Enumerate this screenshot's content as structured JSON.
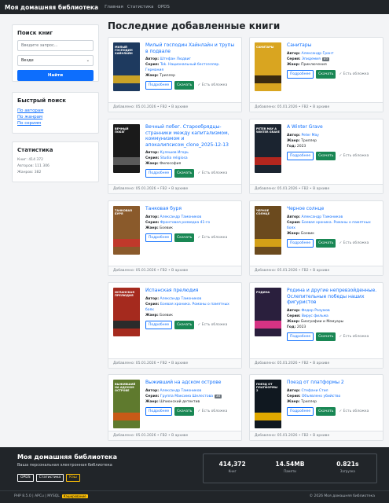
{
  "nav": {
    "brand": "Моя домашняя библиотека",
    "links": [
      "Главная",
      "Статистика",
      "OPDS"
    ]
  },
  "search": {
    "title": "Поиск книг",
    "placeholder": "Введите запрос...",
    "scope": "Везде",
    "button": "Найти"
  },
  "quick": {
    "title": "Быстрый поиск",
    "links": [
      "По авторам",
      "По жанрам",
      "По сериям"
    ]
  },
  "stats": {
    "title": "Статистика",
    "lines": [
      "Книг: 414 372",
      "Авторов: 111 306",
      "Жанров: 382"
    ]
  },
  "main": {
    "title": "Последние добавленные книги"
  },
  "labels": {
    "author": "Автор:",
    "series": "Серия:",
    "genre": "Жанр:",
    "year": "Год:",
    "details": "Подробнее",
    "download": "Скачать",
    "has_cover": "✓ Есть обложка"
  },
  "books": [
    {
      "title": "Милый господин Хайнлайн и трупы в подвале",
      "author": "Штефан Людвиг",
      "series": "Tok. Национальный бестселлер. Германия",
      "series_badge": "",
      "genre": "Триллер",
      "year": "",
      "footer": "Добавлено: 05.01.2026 • FB2 • В архиве",
      "cover_bg": "#1e3a5f",
      "cover_band": "#c9a227",
      "cover_text": "Милый господин Хайнлайн"
    },
    {
      "title": "Санитары",
      "author": "Александр Грант",
      "series": "Эпидемия",
      "series_badge": "#3",
      "genre": "Приключения",
      "year": "",
      "footer": "Добавлено: 05.01.2026 • FB2 • В архиве",
      "cover_bg": "#d9a520",
      "cover_band": "#3a2a10",
      "cover_text": "Санитары"
    },
    {
      "title": "Вечный побег. Старообрядцы-странники между капитализмом, коммунизмом и апокалипсисом_clone_2025-12-13",
      "author": "Кулешов Игорь",
      "series": "Studia religiosa",
      "series_badge": "",
      "genre": "Философия",
      "year": "",
      "footer": "Добавлено: 05.01.2026 • FB2 • В архиве",
      "cover_bg": "#1a1a1a",
      "cover_band": "#5a5a5a",
      "cover_text": "Вечный побег"
    },
    {
      "title": "A Winter Grave",
      "author": "Peter May",
      "series": "",
      "series_badge": "",
      "genre": "Триллер",
      "year": "2023",
      "footer": "Добавлено: 05.01.2026 • FB2 • В архиве",
      "cover_bg": "#1b2430",
      "cover_band": "#b3261e",
      "cover_text": "Peter May A Winter Grave"
    },
    {
      "title": "Танковая буря",
      "author": "Александр Тамоников",
      "series": "Фронтовая разведка 41-го",
      "series_badge": "",
      "genre": "Боевик",
      "year": "",
      "footer": "Добавлено: 05.01.2026 • FB2 • В архиве",
      "cover_bg": "#8a5a2b",
      "cover_band": "#c0392b",
      "cover_text": "Танковая буря"
    },
    {
      "title": "Черное солнце",
      "author": "Александр Тамоников",
      "series": "Боевая хроника. Романы о памятных боях",
      "series_badge": "",
      "genre": "Боевик",
      "year": "",
      "footer": "Добавлено: 05.01.2026 • FB2 • В архиве",
      "cover_bg": "#6b4a1e",
      "cover_band": "#d4a017",
      "cover_text": "Черное солнце"
    },
    {
      "title": "Испанская прелюдия",
      "author": "Александр Тамоников",
      "series": "Боевая хроника. Романы о памятных боях",
      "series_badge": "",
      "genre": "Боевик",
      "year": "",
      "footer": "Добавлено: 05.01.2026 • FB2 • В архиве",
      "cover_bg": "#a52a1e",
      "cover_band": "#2b2b2b",
      "cover_text": "Испанская прелюдия"
    },
    {
      "title": "Родина и другие непревзойденные. Ослепительные победы наших фигуристов",
      "author": "Федор Разумов",
      "series": "Вирус фильма",
      "series_badge": "",
      "genre": "Биографии и Мемуары",
      "year": "2023",
      "footer": "Добавлено: 05.01.2026 • FB2 • В архиве",
      "cover_bg": "#2a1f3d",
      "cover_band": "#d63384",
      "cover_text": "Родина"
    },
    {
      "title": "Выживший на адском острове",
      "author": "Александр Тамоников",
      "series": "Группа Максима Шелестова",
      "series_badge": "#8",
      "genre": "Шпионский детектив",
      "year": "",
      "footer": "Добавлено: 05.01.2026 • FB2 • В архиве",
      "cover_bg": "#5f7a2e",
      "cover_band": "#c85a17",
      "cover_text": "Выживший на адском острове"
    },
    {
      "title": "Поезд от платформы 2",
      "author": "Стефани Стил",
      "series": "Объявлено убийство",
      "series_badge": "",
      "genre": "Триллер",
      "year": "",
      "footer": "Добавлено: 05.01.2026 • FB2 • В архиве",
      "cover_bg": "#101820",
      "cover_band": "#e0a800",
      "cover_text": "Поезд от платформы 2"
    }
  ],
  "footer": {
    "title": "Моя домашняя библиотека",
    "subtitle": "Ваша персональная электронная библиотека",
    "buttons": [
      "OPDS",
      "Статистика",
      "Кэш"
    ],
    "stats": [
      {
        "value": "414,372",
        "label": "Книг"
      },
      {
        "value": "14.54MB",
        "label": "Памяти"
      },
      {
        "value": "0.821s",
        "label": "Загрузка"
      }
    ],
    "tech": "PHP 8.5.0 | APCu | MYSQL",
    "cache_badge": "Кэширование",
    "copyright": "© 2026 Моя домашняя библиотека"
  },
  "colors": {
    "primary": "#0d6efd",
    "success": "#198754",
    "dark": "#212529",
    "warning": "#ffc107"
  }
}
